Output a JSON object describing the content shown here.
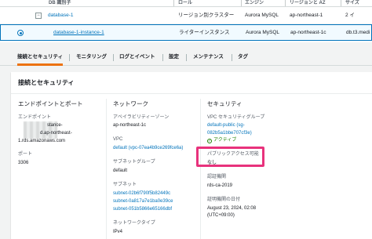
{
  "table": {
    "headers": {
      "db_id": "DB 識別子",
      "role": "ロール",
      "engine": "エンジン",
      "region": "リージョンと AZ",
      "size": "サイズ"
    },
    "rows": [
      {
        "id": "database-1",
        "role": "リージョン別クラスター",
        "engine": "Aurora MySQL",
        "region": "ap-northeast-1",
        "size": "2 イ"
      },
      {
        "id": "database-1-instance-1",
        "role": "ライターインスタンス",
        "engine": "Aurora MySQL",
        "region": "ap-northeast-1c",
        "size": "db.t3.medi"
      }
    ],
    "expand_symbol": "−"
  },
  "tabs": [
    "接続とセキュリティ",
    "モニタリング",
    "ログとイベント",
    "設定",
    "メンテナンス",
    "タグ"
  ],
  "panel": {
    "title": "接続とセキュリティ",
    "endpoint_col": {
      "title": "エンドポイントとポート",
      "endpoint_label": "エンドポイント",
      "endpoint_line1": "stance-",
      "endpoint_line2": "d.ap-northeast-",
      "endpoint_line3": "1.rds.amazonaws.com",
      "port_label": "ポート",
      "port_value": "3306"
    },
    "network_col": {
      "title": "ネットワーク",
      "az_label": "アベイラビリティーゾーン",
      "az_value": "ap-northeast-1c",
      "vpc_label": "VPC",
      "vpc_value": "default (vpc-07ea4b9ce269fce6a)",
      "subnet_group_label": "サブネットグループ",
      "subnet_group_value": "default",
      "subnets_label": "サブネット",
      "subnets": [
        "subnet-02b6f790f5b82449c",
        "subnet-0a817a7e1ba0e39ce",
        "subnet-051b5866e65166dbf"
      ],
      "network_type_label": "ネットワークタイプ",
      "network_type_value": "IPv4"
    },
    "security_col": {
      "title": "セキュリティ",
      "sg_label": "VPC セキュリティグループ",
      "sg_line1": "default-public (sg-",
      "sg_line2": "082b5a1bbe707cf3e)",
      "sg_status_icon": "check-circle-icon",
      "sg_status": "アクティブ",
      "public_access_label": "パブリックアクセス可能",
      "public_access_value": "なし",
      "ca_label": "認証機関",
      "ca_value": "rds-ca-2019",
      "cert_date_label": "証明機関の日付",
      "cert_date_line1": "August 23, 2024, 02:08",
      "cert_date_line2": "(UTC+09:00)"
    }
  },
  "colors": {
    "link": "#0073bb",
    "tab_accent": "#ec7211",
    "highlight": "#e8327c",
    "success": "#1d8102"
  }
}
